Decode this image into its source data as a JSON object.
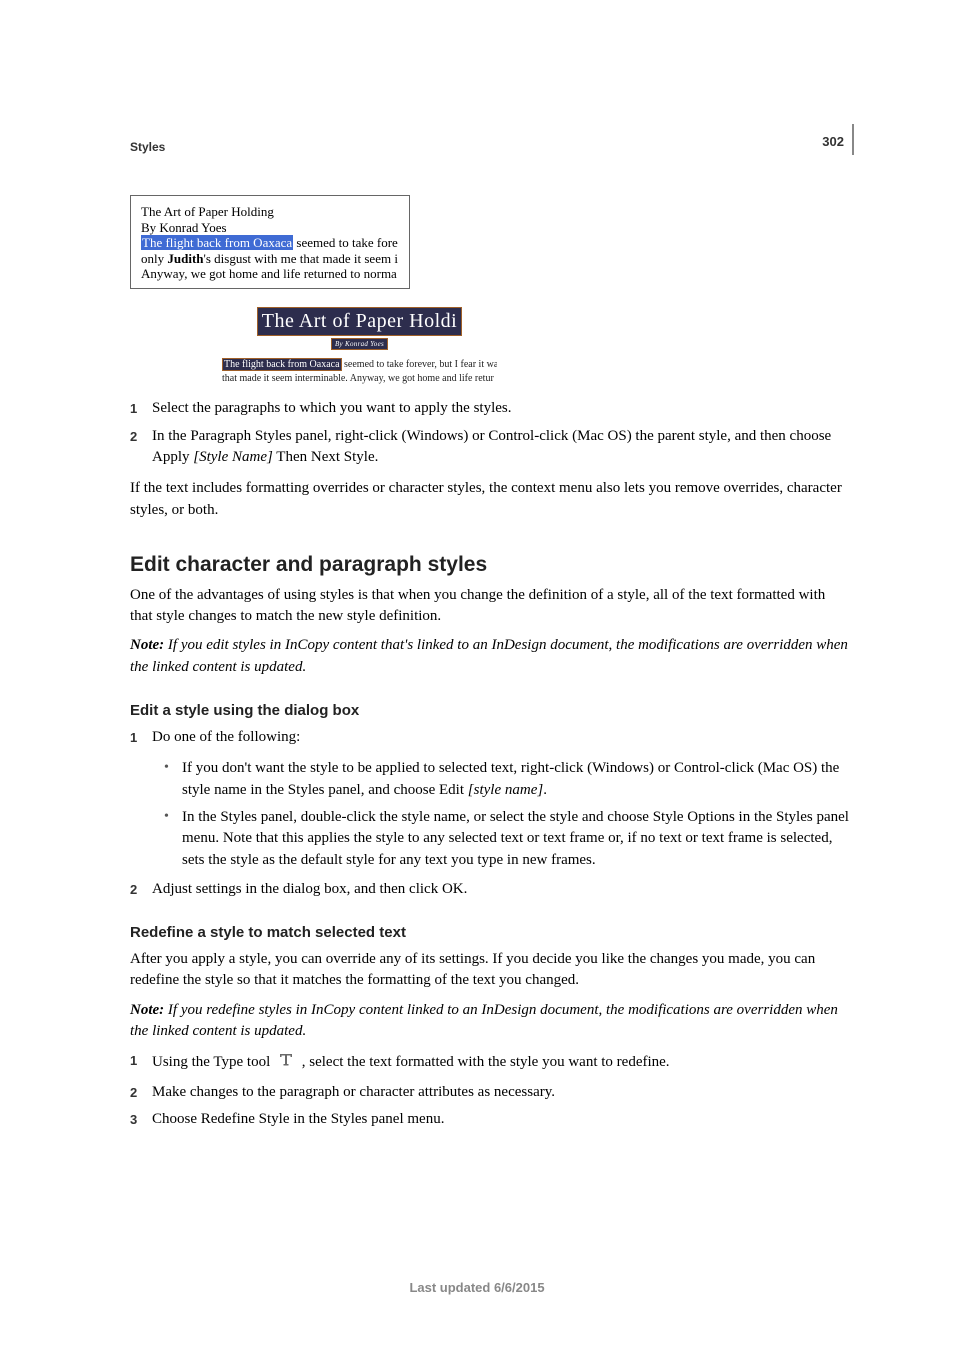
{
  "header": {
    "section_label": "Styles",
    "page_number": "302"
  },
  "figure": {
    "before": {
      "line1": "The Art of Paper Holding",
      "line2": "By Konrad Yoes",
      "line3_hl": "The flight back from Oaxaca",
      "line3_rest": " seemed to take fore",
      "line4_pre": "only ",
      "line4_bold": "Judith",
      "line4_rest": "'s disgust with me that made it seem i",
      "line5": "Anyway, we got home and life returned to norma"
    },
    "after": {
      "title": "The Art of Paper Holdi",
      "byline": "By Konrad Yoes",
      "body_hl": "The flight back from Oaxaca",
      "body_line1_rest": " seemed to take forever, but I fear it wa",
      "body_line2": "that made it seem interminable. Anyway, we got home and life retur"
    }
  },
  "steps_a": {
    "s1": "Select the paragraphs to which you want to apply the styles.",
    "s2_pre": "In the Paragraph Styles panel, right-click (Windows) or Control-click (Mac OS) the parent style, and then choose Apply ",
    "s2_em": "[Style Name]",
    "s2_post": " Then Next Style."
  },
  "para_after_steps_a": "If the text includes formatting overrides or character styles, the context menu also lets you remove overrides, character styles, or both.",
  "h2_edit": "Edit character and paragraph styles",
  "edit_intro": "One of the advantages of using styles is that when you change the definition of a style, all of the text formatted with that style changes to match the new style definition.",
  "note1_label": "Note:",
  "note1_body": " If you edit styles in InCopy content that's linked to an InDesign document, the modifications are overridden when the linked content is updated.",
  "h3_edit_dialog": "Edit a style using the dialog box",
  "steps_b": {
    "s1": "Do one of the following:",
    "b1_pre": "If you don't want the style to be applied to selected text, right-click (Windows) or Control-click (Mac OS) the style name in the Styles panel, and choose Edit ",
    "b1_em": "[style name]",
    "b1_post": ".",
    "b2": "In the Styles panel, double-click the style name, or select the style and choose Style Options in the Styles panel menu. Note that this applies the style to any selected text or text frame or, if no text or text frame is selected, sets the style as the default style for any text you type in new frames.",
    "s2": "Adjust settings in the dialog box, and then click OK."
  },
  "h3_redefine": "Redefine a style to match selected text",
  "redefine_intro": "After you apply a style, you can override any of its settings. If you decide you like the changes you made, you can redefine the style so that it matches the formatting of the text you changed.",
  "note2_label": "Note:",
  "note2_body": " If you redefine styles in InCopy content linked to an InDesign document, the modifications are overridden when the linked content is updated.",
  "steps_c": {
    "s1_pre": "Using the Type tool ",
    "s1_post": " , select the text formatted with the style you want to redefine.",
    "s2": "Make changes to the paragraph or character attributes as necessary.",
    "s3": "Choose Redefine Style in the Styles panel menu."
  },
  "footer": {
    "text": "Last updated 6/6/2015"
  }
}
